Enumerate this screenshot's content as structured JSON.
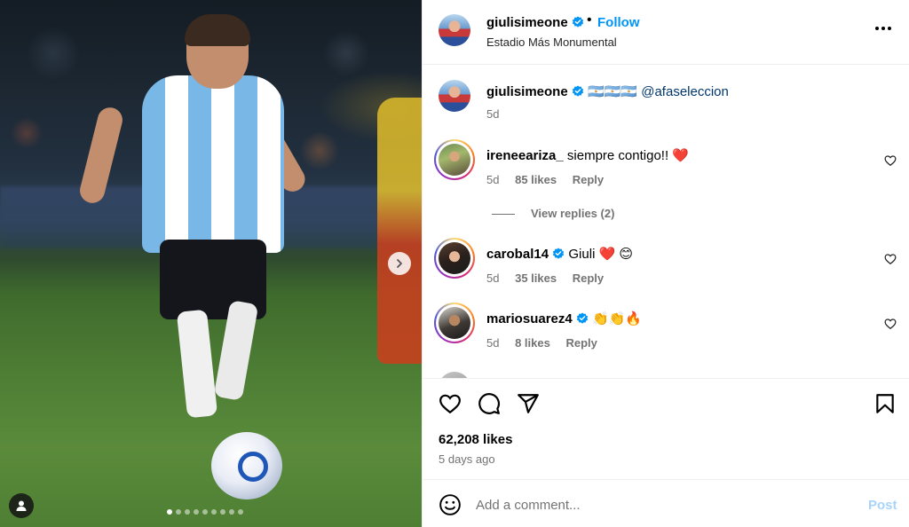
{
  "post": {
    "author": "giulisimeone",
    "follow_label": "Follow",
    "dot_separator": "•",
    "location": "Estadio Más Monumental",
    "carousel_total": 9,
    "carousel_active": 0
  },
  "caption": {
    "username": "giulisimeone",
    "flags": "🇦🇷🇦🇷🇦🇷",
    "mention": "@afaseleccion",
    "age": "5d"
  },
  "comments": [
    {
      "username": "ireneeariza_",
      "text": "siempre contigo!! ❤️",
      "age": "5d",
      "likes": "85 likes",
      "reply": "Reply",
      "verified": false
    },
    {
      "username": "carobal14",
      "text": "Giuli ❤️ 😊",
      "age": "5d",
      "likes": "35 likes",
      "reply": "Reply",
      "verified": true
    },
    {
      "username": "mariosuarez4",
      "text": "👏👏🔥",
      "age": "5d",
      "likes": "8 likes",
      "reply": "Reply",
      "verified": true
    }
  ],
  "view_replies": "View replies (2)",
  "stats": {
    "likes": "62,208 likes",
    "time_ago": "5 days ago"
  },
  "composer": {
    "placeholder": "Add a comment...",
    "post_label": "Post"
  },
  "colors": {
    "accent": "#0095f6",
    "post_disabled": "#a8d4fb",
    "muted": "#737373",
    "link": "#00376b"
  },
  "icons": {
    "verified": "verified-badge-icon",
    "more": "more-horizontal-icon",
    "heart": "heart-icon",
    "comment": "comment-icon",
    "share": "share-icon",
    "save": "bookmark-icon",
    "emoji": "emoji-icon",
    "next": "chevron-right-icon",
    "tagged": "user-tag-icon"
  }
}
